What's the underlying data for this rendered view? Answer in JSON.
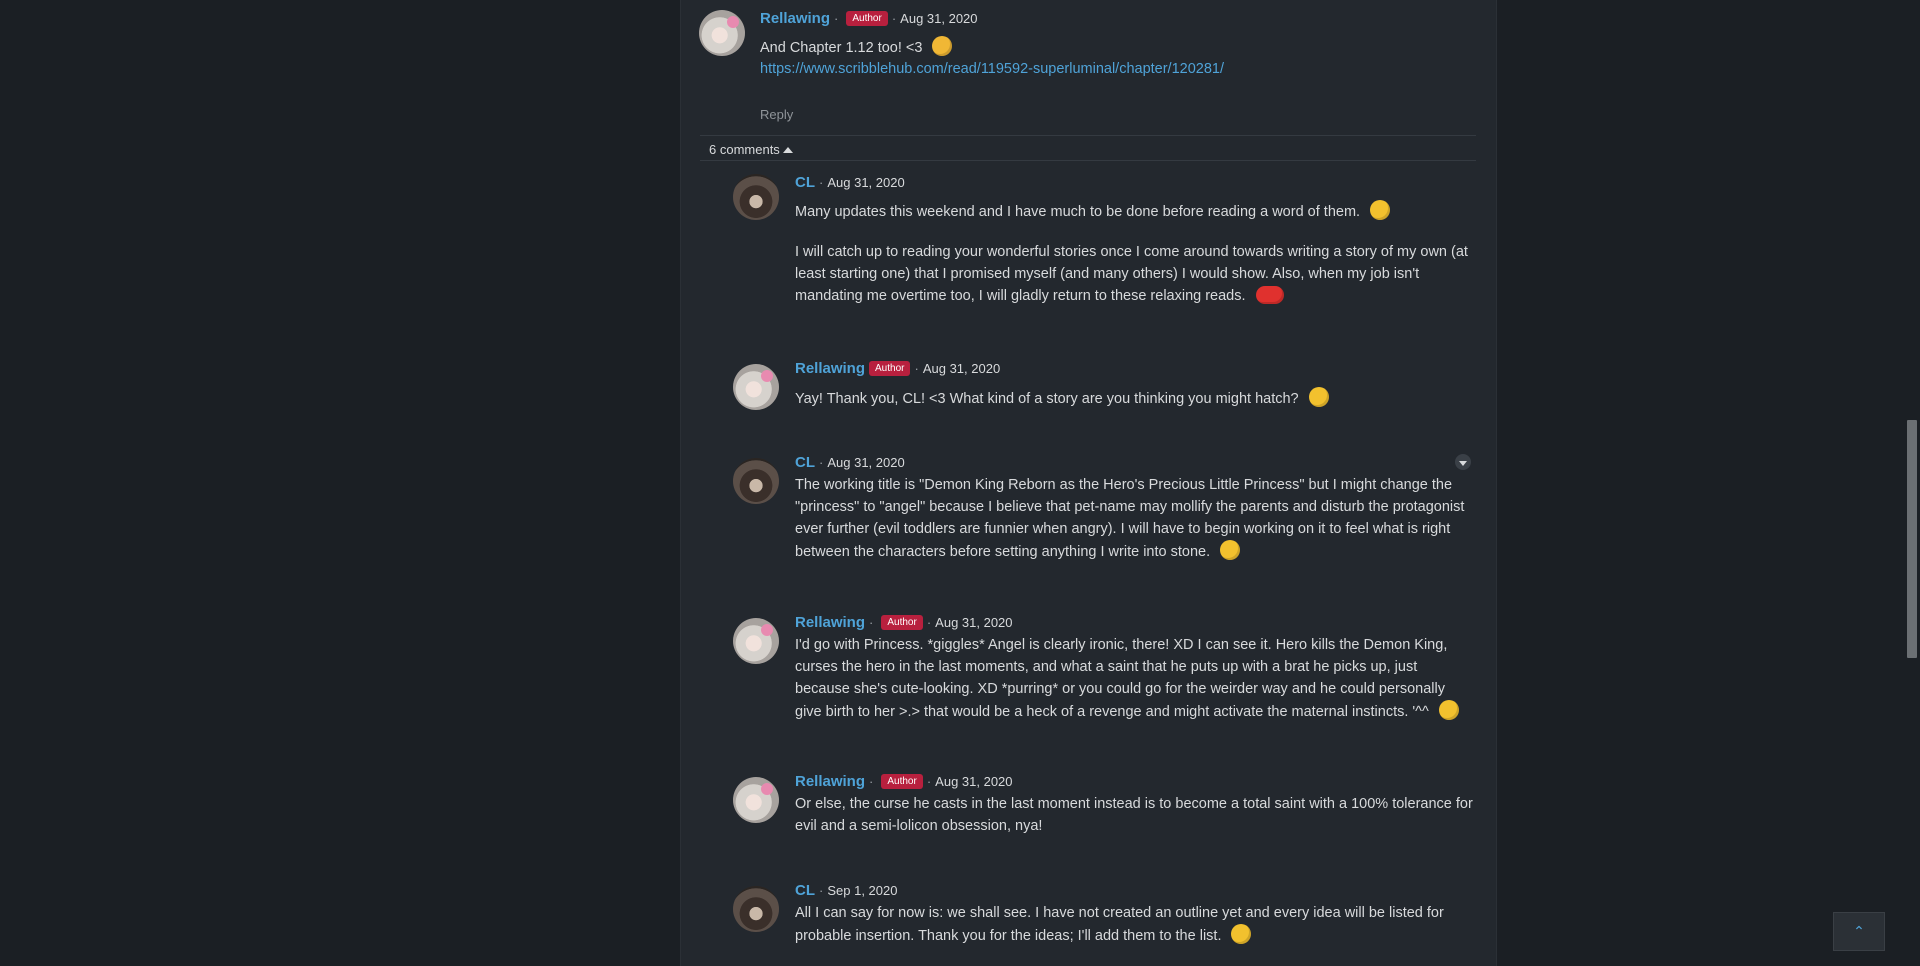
{
  "top_comment": {
    "author": "Rellawing",
    "badge": "Author",
    "date": "Aug 31, 2020",
    "text": "And Chapter 1.12 too! <3",
    "link": "https://www.scribblehub.com/read/119592-superluminal/chapter/120281/",
    "reply_label": "Reply"
  },
  "replies_toggle": {
    "label": "6 comments"
  },
  "replies": [
    {
      "author": "CL",
      "date": "Aug 31, 2020",
      "paragraphs": [
        "Many updates this weekend and I have much to be done before reading a word of them.",
        "I will catch up to reading your wonderful stories once I come around towards writing a story of my own (at least starting one) that I promised myself (and many others) I would show.  Also, when my job isn't mandating me overtime too, I will gladly return to these relaxing reads."
      ]
    },
    {
      "author": "Rellawing",
      "badge": "Author",
      "date": "Aug 31, 2020",
      "paragraphs": [
        "Yay! Thank you, CL! <3  What kind of a story are you thinking you might hatch?"
      ]
    },
    {
      "author": "CL",
      "date": "Aug 31, 2020",
      "paragraphs": [
        "The working title is \"Demon King Reborn as the Hero's Precious Little Princess\" but I might change the \"princess\" to \"angel\" because I believe that pet-name may mollify the parents and disturb the protagonist ever further (evil toddlers are funnier when angry).  I will have to begin working on it to feel what is right between the characters before setting anything I write into stone."
      ]
    },
    {
      "author": "Rellawing",
      "badge": "Author",
      "date": "Aug 31, 2020",
      "paragraphs": [
        "I'd go with Princess.  *giggles*  Angel is clearly ironic, there! XD  I can see it.  Hero kills the Demon King, curses the hero in the last moments, and what a saint that he puts up with a brat he picks up, just because she's cute-looking. XD  *purring* or you could go for the weirder way and he could personally give birth to her >.> that would be a heck of a revenge and might activate the maternal instincts. '^^"
      ]
    },
    {
      "author": "Rellawing",
      "badge": "Author",
      "date": "Aug 31, 2020",
      "paragraphs": [
        "Or else, the curse he casts in the last moment instead is to become a total saint with a 100% tolerance for evil and a semi-lolicon obsession, nya!"
      ]
    },
    {
      "author": "CL",
      "date": "Sep 1, 2020",
      "paragraphs": [
        "All I can say for now is: we shall see.  I have not created an outline yet and every idea will be listed for probable insertion.  Thank you for the ideas; I'll add them to the list."
      ]
    }
  ]
}
